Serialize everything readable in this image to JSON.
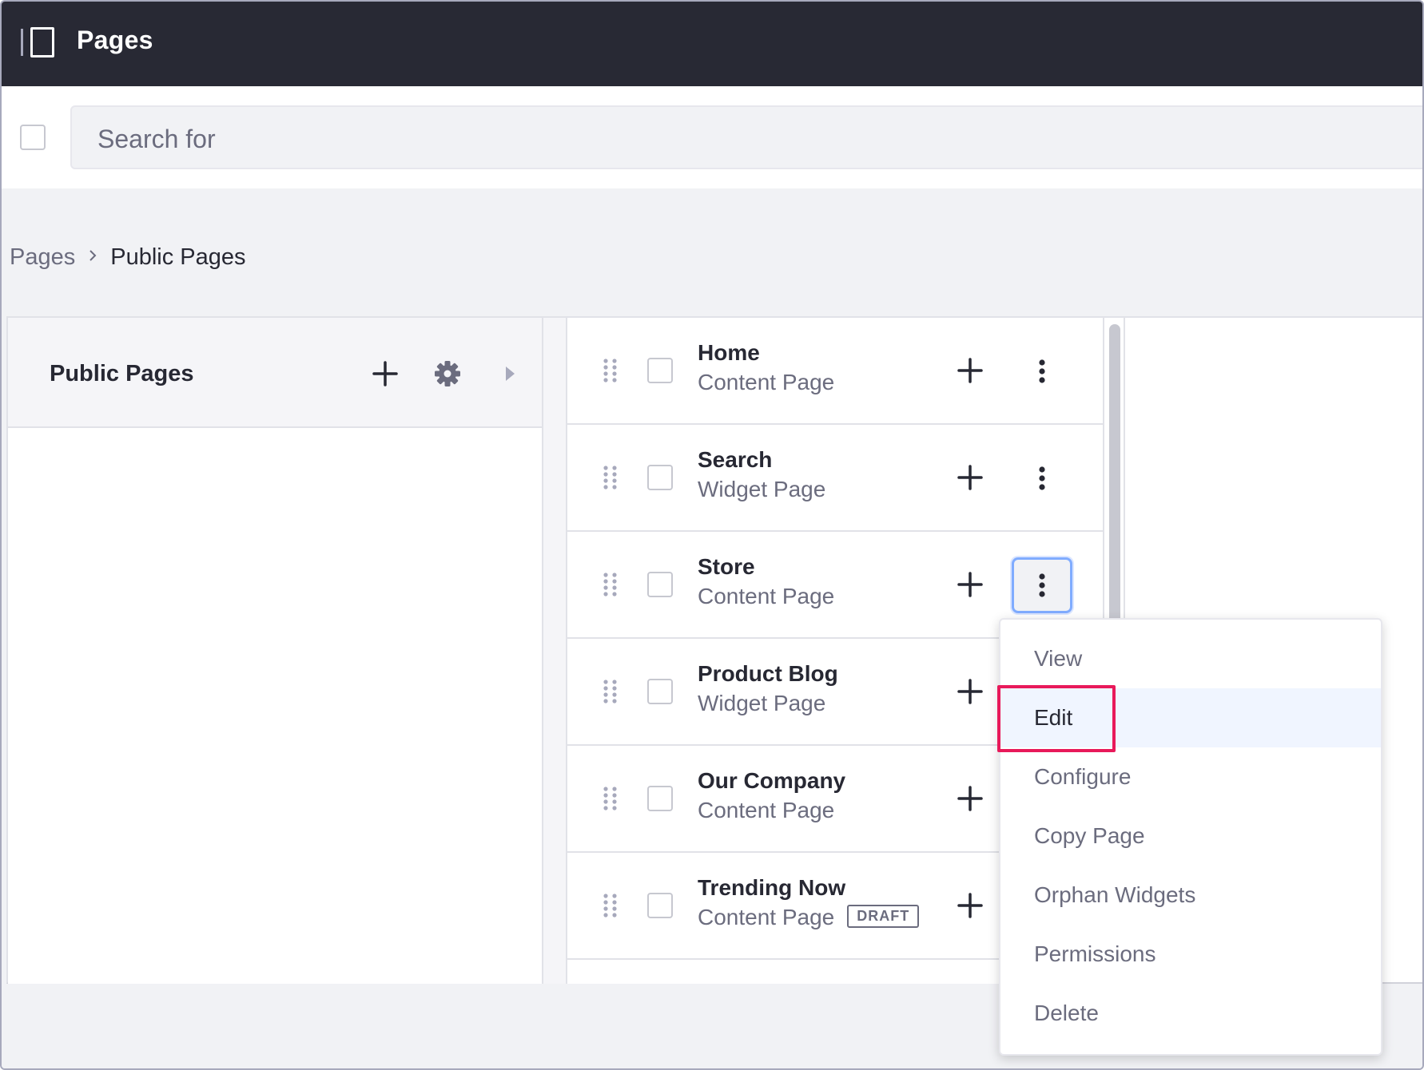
{
  "header": {
    "title": "Pages",
    "panel_toggle_icon": "sidebar-panel-icon",
    "background": "#282934"
  },
  "search": {
    "placeholder": "Search for",
    "value": ""
  },
  "breadcrumb": {
    "items": [
      {
        "label": "Pages"
      },
      {
        "label": "Public Pages"
      }
    ],
    "separator_icon": "chevron-right-icon"
  },
  "left_column": {
    "title": "Public Pages",
    "add_icon": "plus-icon",
    "settings_icon": "gear-icon",
    "expand_icon": "caret-right-icon"
  },
  "pages": [
    {
      "name": "Home",
      "type": "Content Page",
      "badge": ""
    },
    {
      "name": "Search",
      "type": "Widget Page",
      "badge": ""
    },
    {
      "name": "Store",
      "type": "Content Page",
      "badge": ""
    },
    {
      "name": "Product Blog",
      "type": "Widget Page",
      "badge": ""
    },
    {
      "name": "Our Company",
      "type": "Content Page",
      "badge": ""
    },
    {
      "name": "Trending Now",
      "type": "Content Page",
      "badge": "DRAFT"
    }
  ],
  "dropdown": {
    "open_for": "Store",
    "items": [
      {
        "label": "View"
      },
      {
        "label": "Edit"
      },
      {
        "label": "Configure"
      },
      {
        "label": "Copy Page"
      },
      {
        "label": "Orphan Widgets"
      },
      {
        "label": "Permissions"
      },
      {
        "label": "Delete"
      }
    ],
    "selected": "Edit",
    "highlight_color": "#e8195a",
    "focus_color": "#80acff"
  }
}
